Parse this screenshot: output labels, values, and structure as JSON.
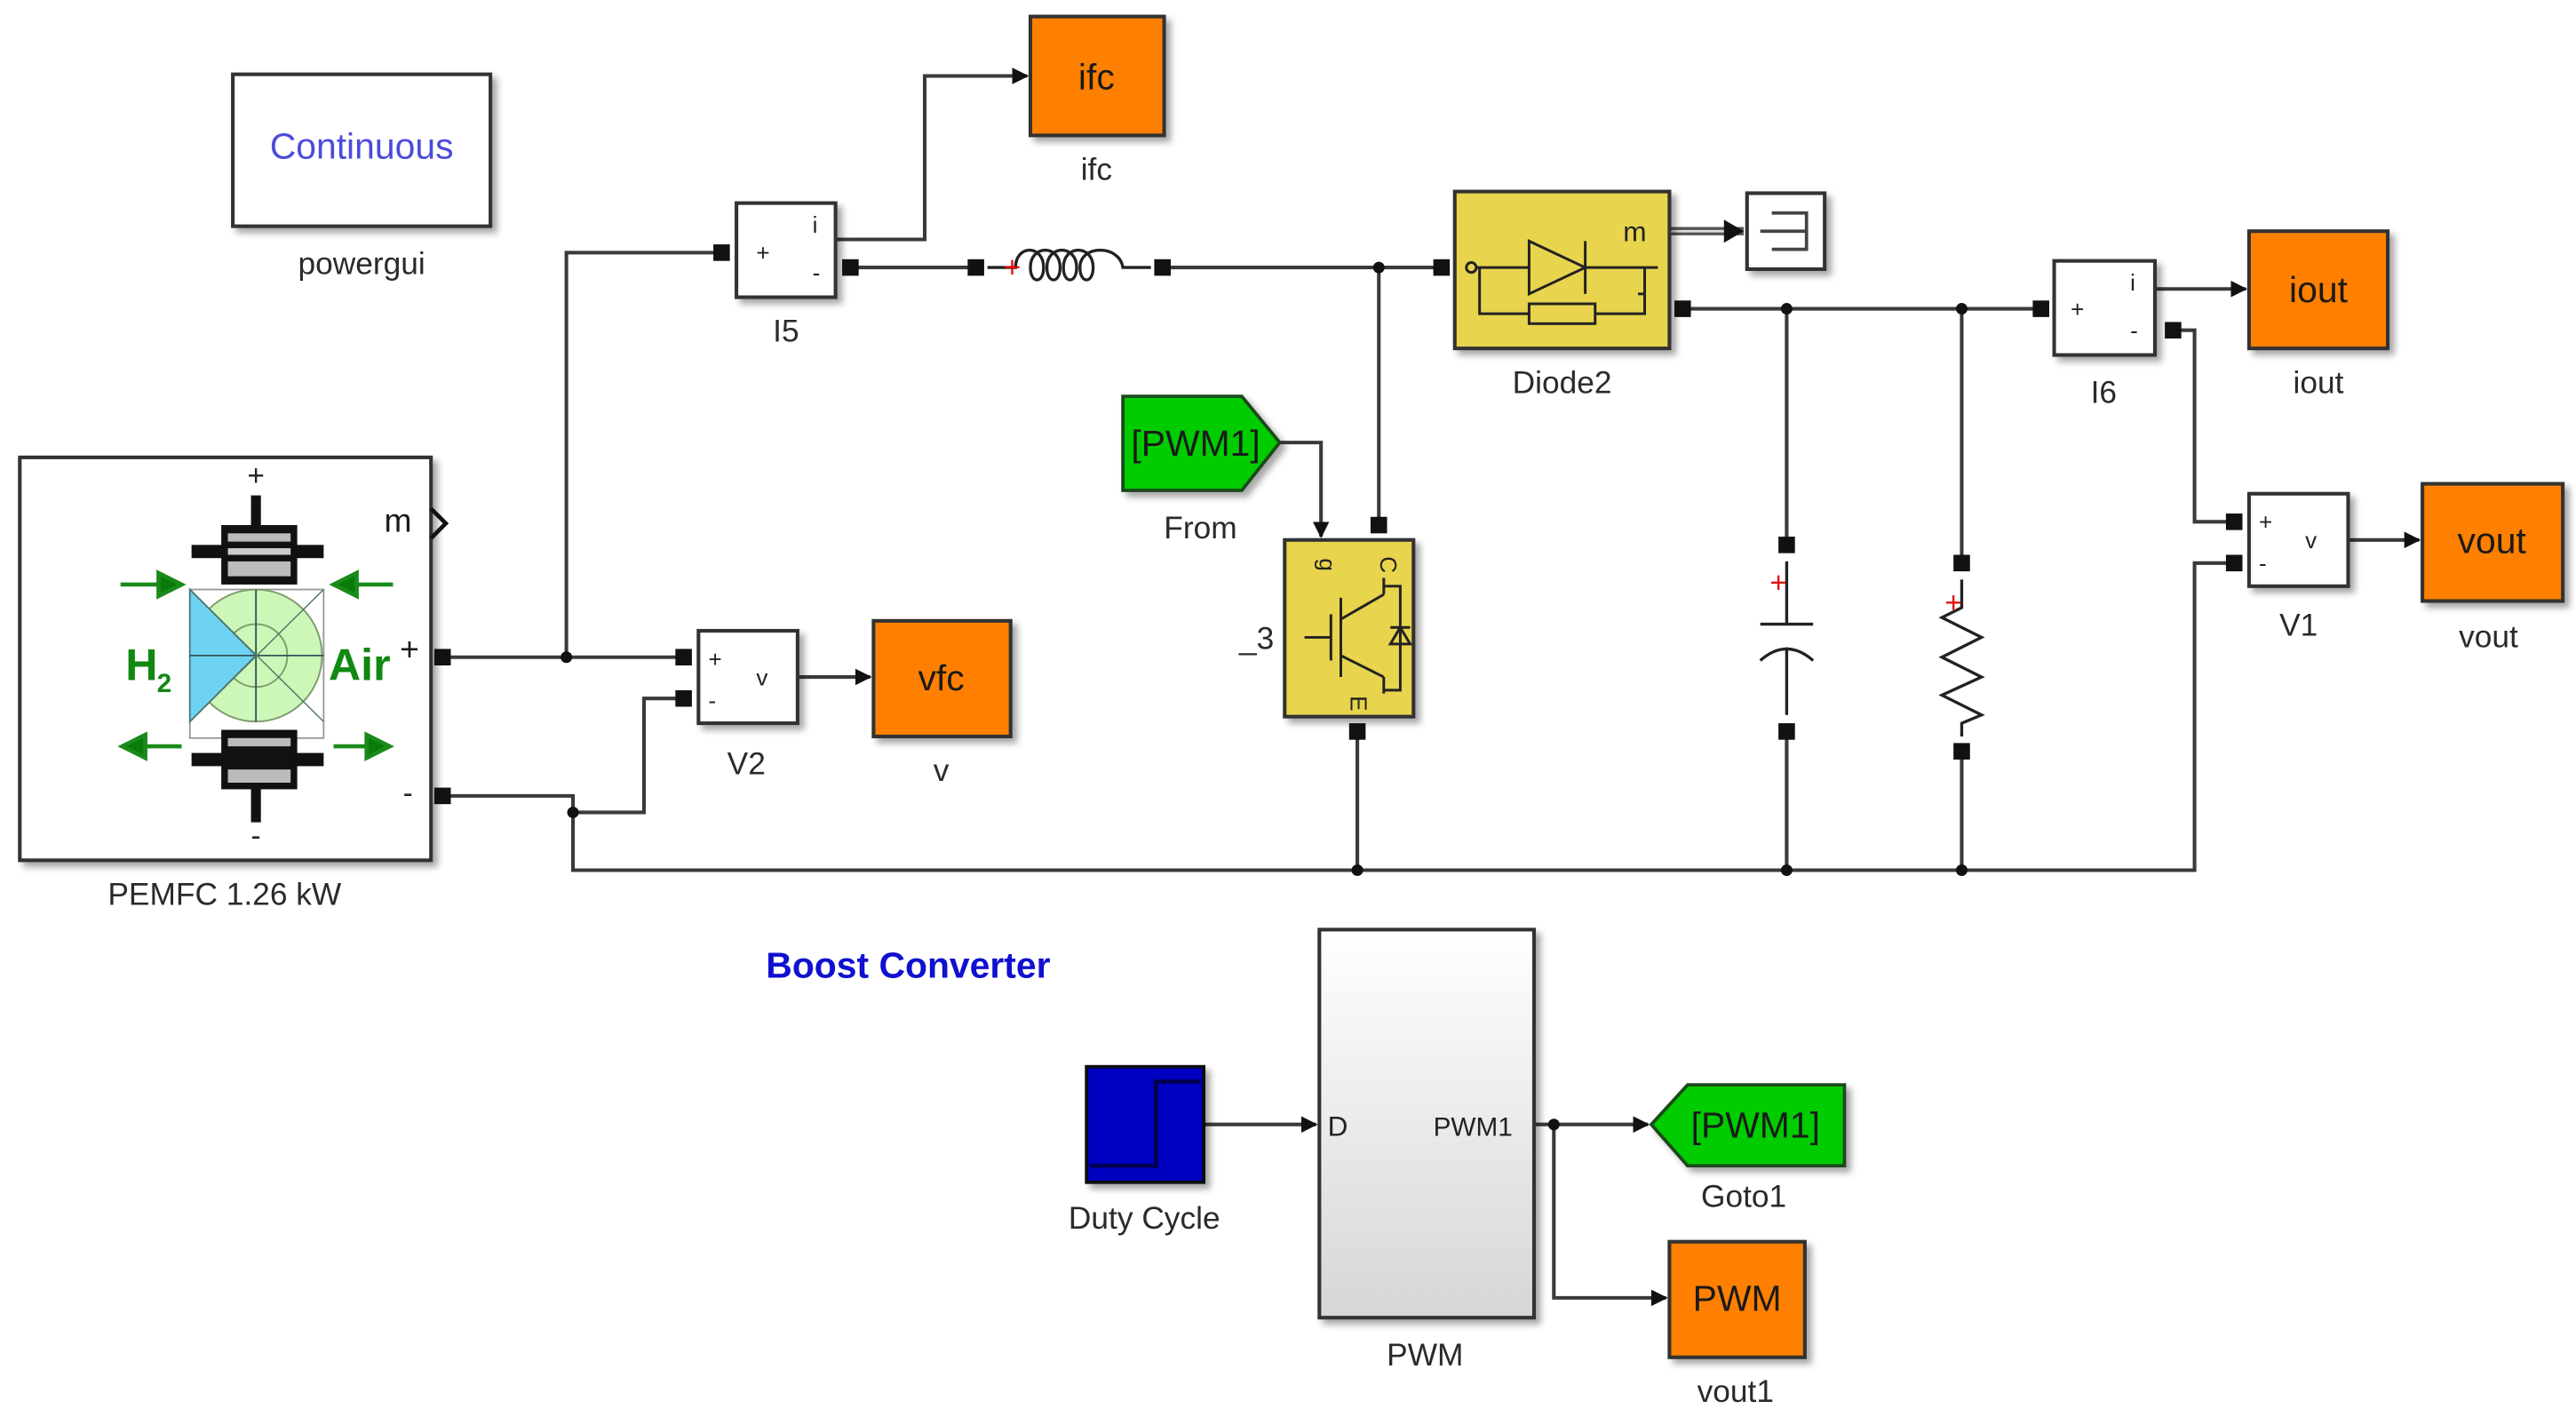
{
  "diagram": {
    "title_annotation": "Boost Converter",
    "colors": {
      "scope_orange": "#ff8000",
      "tag_green": "#00cc00",
      "power_yellow": "#e8d44d",
      "step_blue": "#0000c0",
      "annotation_blue": "#1010d0",
      "powergui_text": "#4b4bdc"
    },
    "blocks": {
      "powergui": {
        "text": "Continuous",
        "label": "powergui"
      },
      "fuel_cell": {
        "label": "PEMFC 1.26 kW",
        "h2": "H",
        "h2_sub": "2",
        "air": "Air",
        "port_m": "m",
        "port_plus": "+",
        "port_minus": "-",
        "top_sign": "+",
        "bottom_sign": "-"
      },
      "i5": {
        "label": "I5",
        "plus": "+",
        "minus": "-",
        "out": "i"
      },
      "ifc": {
        "text": "ifc",
        "label": "ifc"
      },
      "inductor": {
        "sign": "+"
      },
      "diode": {
        "label": "Diode2",
        "port_m": "m"
      },
      "terminator": {
        "label": ""
      },
      "igbt": {
        "label": "_3",
        "g": "g",
        "c": "C",
        "e": "E"
      },
      "from": {
        "text": "[PWM1]",
        "label": "From"
      },
      "capacitor": {
        "sign": "+"
      },
      "resistor": {
        "sign": "+"
      },
      "i6": {
        "label": "I6",
        "plus": "+",
        "minus": "-",
        "out": "i"
      },
      "iout": {
        "text": "iout",
        "label": "iout"
      },
      "v1": {
        "label": "V1",
        "plus": "+",
        "minus": "-",
        "out": "v"
      },
      "vout": {
        "text": "vout",
        "label": "vout"
      },
      "v2": {
        "label": "V2",
        "plus": "+",
        "minus": "-",
        "out": "v"
      },
      "vfc": {
        "text": "vfc",
        "label": "v"
      },
      "duty_cycle": {
        "label": "Duty Cycle"
      },
      "pwm": {
        "label": "PWM",
        "in_port": "D",
        "out_port": "PWM1"
      },
      "goto1": {
        "text": "[PWM1]",
        "label": "Goto1"
      },
      "vout1": {
        "text": "PWM",
        "label": "vout1"
      }
    }
  }
}
